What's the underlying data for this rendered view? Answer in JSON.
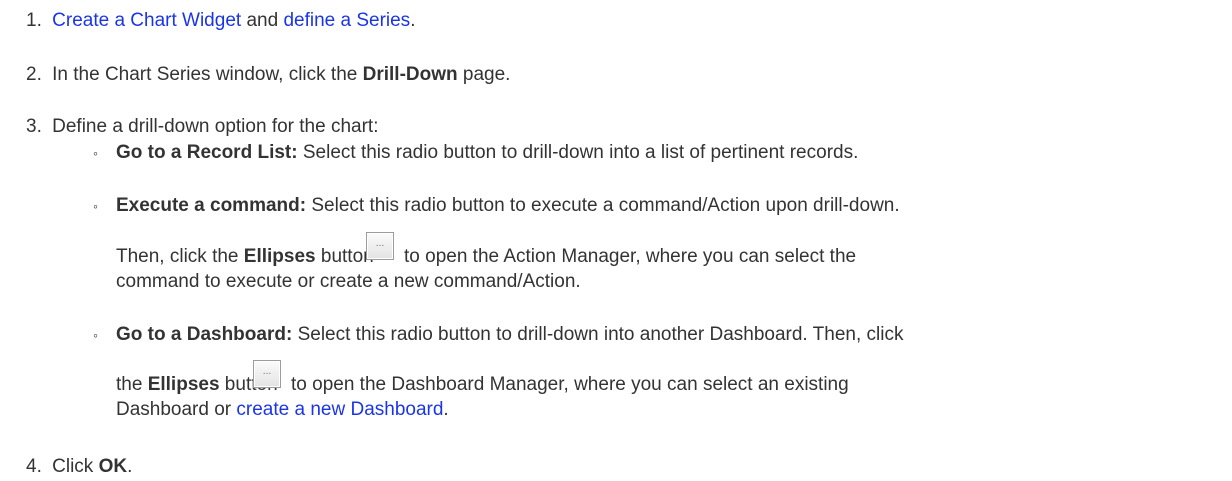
{
  "steps": {
    "s1": {
      "num": "1.",
      "link1": "Create a Chart Widget",
      "mid": " and ",
      "link2": "define a Series",
      "end": "."
    },
    "s2": {
      "num": "2.",
      "pre": "In the Chart Series window, click the ",
      "bold": "Drill-Down",
      "end": " page."
    },
    "s3": {
      "num": "3.",
      "text": "Define a drill-down option for the chart:",
      "bullet_glyph": "◦",
      "opt1": {
        "bold": "Go to a Record List:",
        "text": " Select this radio button to drill-down into a list of pertinent records."
      },
      "opt2": {
        "bold": "Execute a command:",
        "text": " Select this radio button to execute a command/Action upon drill-down.",
        "p2_pre": "Then, click the ",
        "p2_bold": "Ellipses",
        "p2_mid": " button",
        "p2_after": "to open the Action Manager, where you can select the",
        "p2_line2": "command to execute or create a new command/Action."
      },
      "opt3": {
        "bold": "Go to a Dashboard:",
        "text": " Select this radio button to drill-down into another Dashboard. Then, click",
        "l2_pre": "the ",
        "l2_bold": "Ellipses",
        "l2_mid": " button",
        "l2_after": "to open the Dashboard Manager, where you can select an existing",
        "l3_pre": "Dashboard or ",
        "l3_link": "create a new Dashboard",
        "l3_end": "."
      }
    },
    "s4": {
      "num": "4.",
      "pre": "Click ",
      "bold": "OK",
      "end": "."
    }
  },
  "ellipsis_button": {
    "label": "...",
    "icon": "ellipsis-icon"
  },
  "colors": {
    "text": "#333333",
    "link": "#1a35e8"
  }
}
